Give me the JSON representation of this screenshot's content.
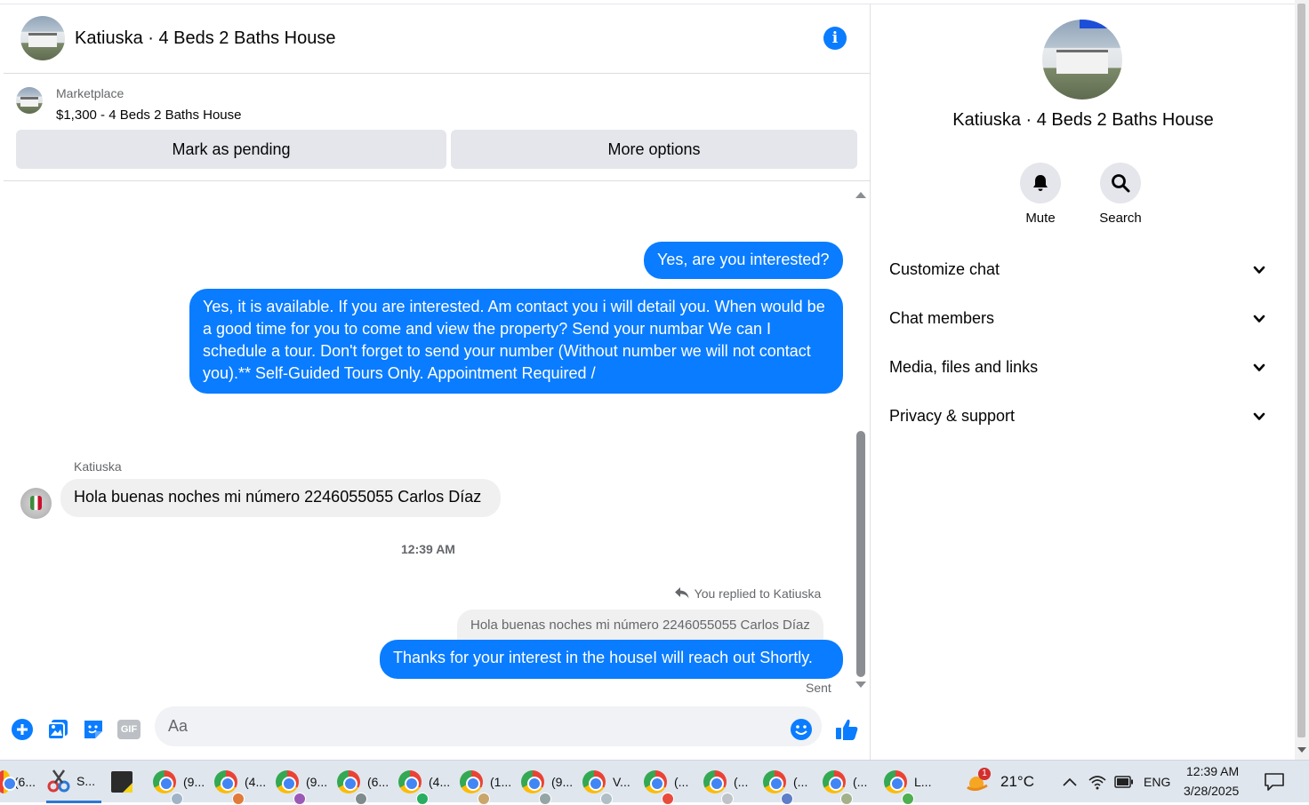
{
  "header": {
    "title": "Katiuska · 4 Beds 2 Baths House"
  },
  "listing": {
    "source": "Marketplace",
    "title": "$1,300 - 4 Beds 2 Baths House",
    "mark_pending_label": "Mark as pending",
    "more_options_label": "More options"
  },
  "messages": {
    "out_1": "Yes, are you interested?",
    "out_2": "Yes, it is available. If you are interested.  Am contact you i will detail you.  When would be a good time for you to come and view the property? Send your numbar We can I schedule a tour.  Don't forget to send your number (Without number we will not contact you).** Self-Guided Tours Only. Appointment Required /",
    "sender_name": "Katiuska",
    "in_1": "Hola buenas noches mi número 2246055055 Carlos Díaz",
    "timestamp": "12:39 AM",
    "reply_label": "You replied to Katiuska",
    "quoted": "Hola buenas noches mi número 2246055055 Carlos Díaz",
    "out_3": "Thanks for your interest in the houseI will reach out Shortly.",
    "status": "Sent"
  },
  "composer": {
    "placeholder": "Aa",
    "gif_label": "GIF"
  },
  "side": {
    "title": "Katiuska · 4 Beds 2 Baths House",
    "mute_label": "Mute",
    "search_label": "Search",
    "sections": [
      "Customize chat",
      "Chat members",
      "Media, files and links",
      "Privacy & support"
    ]
  },
  "taskbar": {
    "apps": [
      {
        "label": "(6..."
      },
      {
        "label": "S..."
      },
      {
        "label": ""
      },
      {
        "label": "(9..."
      },
      {
        "label": "(4..."
      },
      {
        "label": "(9..."
      },
      {
        "label": "(6..."
      },
      {
        "label": "(4..."
      },
      {
        "label": "(1..."
      },
      {
        "label": "(9..."
      },
      {
        "label": "V..."
      },
      {
        "label": "(..."
      },
      {
        "label": "(..."
      },
      {
        "label": "(..."
      },
      {
        "label": "(..."
      },
      {
        "label": "L..."
      }
    ],
    "weather": "21°C",
    "weather_badge": "1",
    "language": "ENG",
    "time": "12:39 AM",
    "date": "3/28/2025"
  },
  "colors": {
    "accent": "#0a7cff",
    "bubble_in": "#f0f0f0",
    "button_bg": "#e4e6eb"
  }
}
